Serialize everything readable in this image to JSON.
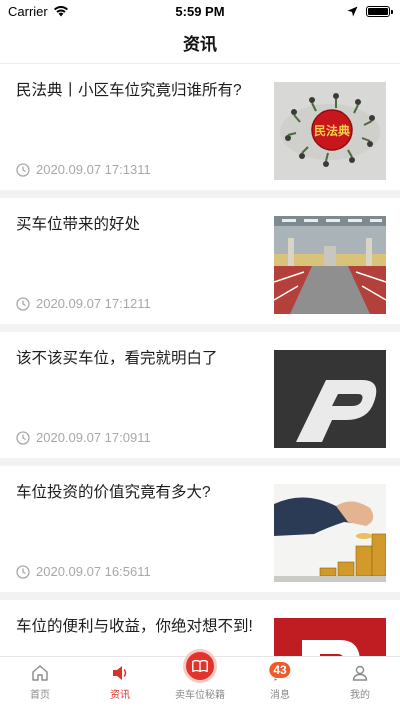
{
  "status_bar": {
    "carrier": "Carrier",
    "time": "5:59 PM"
  },
  "nav": {
    "title": "资讯"
  },
  "articles": [
    {
      "title": "民法典丨小区车位究竟归谁所有?",
      "time": "2020.09.07 17:1311",
      "thumb_icon": "civil-code-seal-image"
    },
    {
      "title": "买车位带来的好处",
      "time": "2020.09.07 17:1211",
      "thumb_icon": "parking-garage-image"
    },
    {
      "title": "该不该买车位，看完就明白了",
      "time": "2020.09.07 17:0911",
      "thumb_icon": "parking-p-marking-image"
    },
    {
      "title": "车位投资的价值究竟有多大?",
      "time": "2020.09.07 16:5611",
      "thumb_icon": "coin-stacks-image"
    },
    {
      "title": "车位的便利与收益，你绝对想不到!",
      "time": "",
      "thumb_icon": "parking-sign-image"
    }
  ],
  "tabs": [
    {
      "label": "首页",
      "icon": "home-icon"
    },
    {
      "label": "资讯",
      "icon": "speaker-icon"
    },
    {
      "label": "卖车位秘籍",
      "icon": "book-icon"
    },
    {
      "label": "消息",
      "icon": "chat-icon",
      "badge": "43"
    },
    {
      "label": "我的",
      "icon": "person-icon"
    }
  ],
  "colors": {
    "accent": "#d9342b",
    "badge": "#f05a28",
    "background": "#f2f2f2"
  }
}
